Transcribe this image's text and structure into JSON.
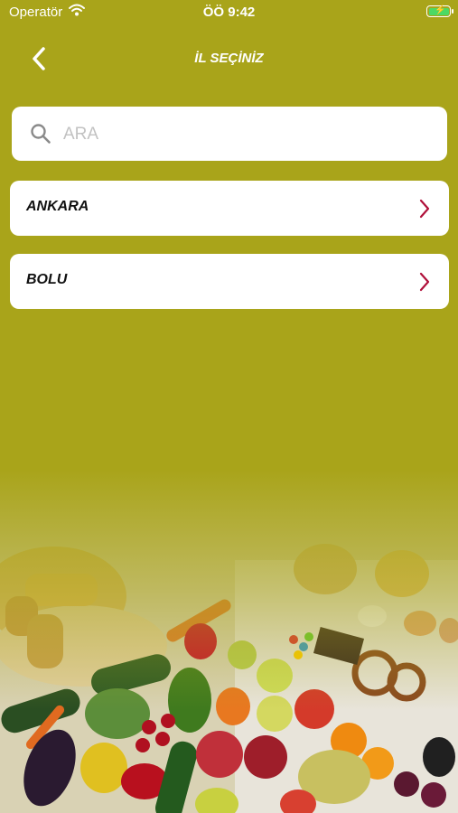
{
  "status_bar": {
    "carrier": "Operatör",
    "time": "ÖÖ 9:42"
  },
  "header": {
    "title": "İL SEÇİNİZ"
  },
  "search": {
    "placeholder": "ARA",
    "value": ""
  },
  "cities": [
    {
      "label": "ANKARA"
    },
    {
      "label": "BOLU"
    }
  ],
  "colors": {
    "background": "#a9a41a",
    "chevron": "#b0103a",
    "card": "#ffffff"
  }
}
